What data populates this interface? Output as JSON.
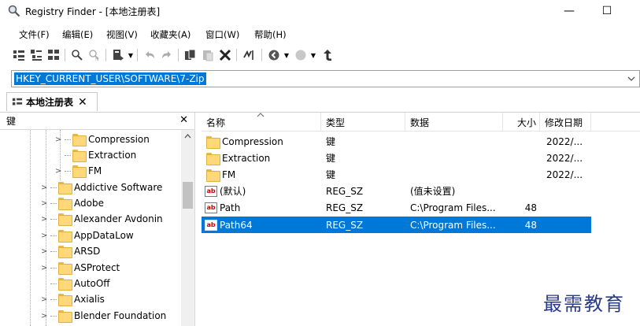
{
  "window": {
    "title": "Registry Finder - [本地注册表]",
    "minimize_glyph": "—",
    "maximize_glyph": "☐"
  },
  "menu": [
    "文件(F)",
    "编辑(E)",
    "视图(V)",
    "收藏夹(A)",
    "窗口(W)",
    "帮助(H)"
  ],
  "address": {
    "path": "HKEY_CURRENT_USER\\SOFTWARE\\7-Zip"
  },
  "tab": {
    "label": "本地注册表",
    "close": "✕"
  },
  "tree": {
    "header": "键",
    "close": "✕",
    "items": [
      {
        "label": "Compression",
        "expandable": true,
        "indent": 2
      },
      {
        "label": "Extraction",
        "expandable": false,
        "indent": 2
      },
      {
        "label": "FM",
        "expandable": true,
        "indent": 2
      },
      {
        "label": "Addictive Software",
        "expandable": true,
        "indent": 1
      },
      {
        "label": "Adobe",
        "expandable": true,
        "indent": 1
      },
      {
        "label": "Alexander Avdonin",
        "expandable": true,
        "indent": 1
      },
      {
        "label": "AppDataLow",
        "expandable": true,
        "indent": 1
      },
      {
        "label": "ARSD",
        "expandable": true,
        "indent": 1
      },
      {
        "label": "ASProtect",
        "expandable": true,
        "indent": 1
      },
      {
        "label": "AutoOff",
        "expandable": false,
        "indent": 1
      },
      {
        "label": "Axialis",
        "expandable": true,
        "indent": 1
      },
      {
        "label": "Blender Foundation",
        "expandable": true,
        "indent": 1
      }
    ]
  },
  "list": {
    "columns": {
      "name": "名称",
      "type": "类型",
      "data": "数据",
      "size": "大小",
      "modified": "修改日期"
    },
    "rows": [
      {
        "icon": "folder",
        "name": "Compression",
        "type": "键",
        "data": "",
        "size": "",
        "modified": "2022/..."
      },
      {
        "icon": "folder",
        "name": "Extraction",
        "type": "键",
        "data": "",
        "size": "",
        "modified": "2022/..."
      },
      {
        "icon": "folder",
        "name": "FM",
        "type": "键",
        "data": "",
        "size": "",
        "modified": "2022/..."
      },
      {
        "icon": "string-value",
        "name": "(默认)",
        "type": "REG_SZ",
        "data": "(值未设置)",
        "size": "",
        "modified": ""
      },
      {
        "icon": "string-value",
        "name": "Path",
        "type": "REG_SZ",
        "data": "C:\\Program Files...",
        "size": "48",
        "modified": ""
      },
      {
        "icon": "string-value",
        "name": "Path64",
        "type": "REG_SZ",
        "data": "C:\\Program Files...",
        "size": "48",
        "modified": "",
        "selected": true
      }
    ],
    "ab_glyph": "ab"
  },
  "watermark": "最需教育",
  "colors": {
    "selection": "#0078d7",
    "folder": "#ffd87a"
  }
}
